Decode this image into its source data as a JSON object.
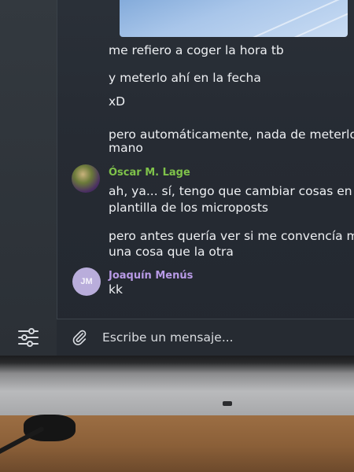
{
  "chat": {
    "messages": [
      {
        "text": "me refiero a coger la hora tb"
      },
      {
        "text": "y meterlo ahí en la fecha"
      },
      {
        "text": "xD"
      },
      {
        "line1": "pero automáticamente, nada de meterlo a",
        "line2": "mano"
      }
    ],
    "group_oscar": {
      "sender": "Óscar M. Lage",
      "sender_color": "#7fc24a",
      "msg1_line1": "ah, ya... sí, tengo que cambiar cosas en la",
      "msg1_line2": "plantilla de los microposts",
      "msg2_line1": "pero antes quería ver si me convencía más",
      "msg2_line2": "una cosa que la otra"
    },
    "group_joaquin": {
      "sender": "Joaquín Menús",
      "sender_color": "#b89ae6",
      "initials": "JM",
      "text": "kk"
    }
  },
  "composer": {
    "placeholder": "Escribe un mensaje...",
    "attach_icon": "paperclip-icon",
    "settings_icon": "sliders-icon"
  }
}
